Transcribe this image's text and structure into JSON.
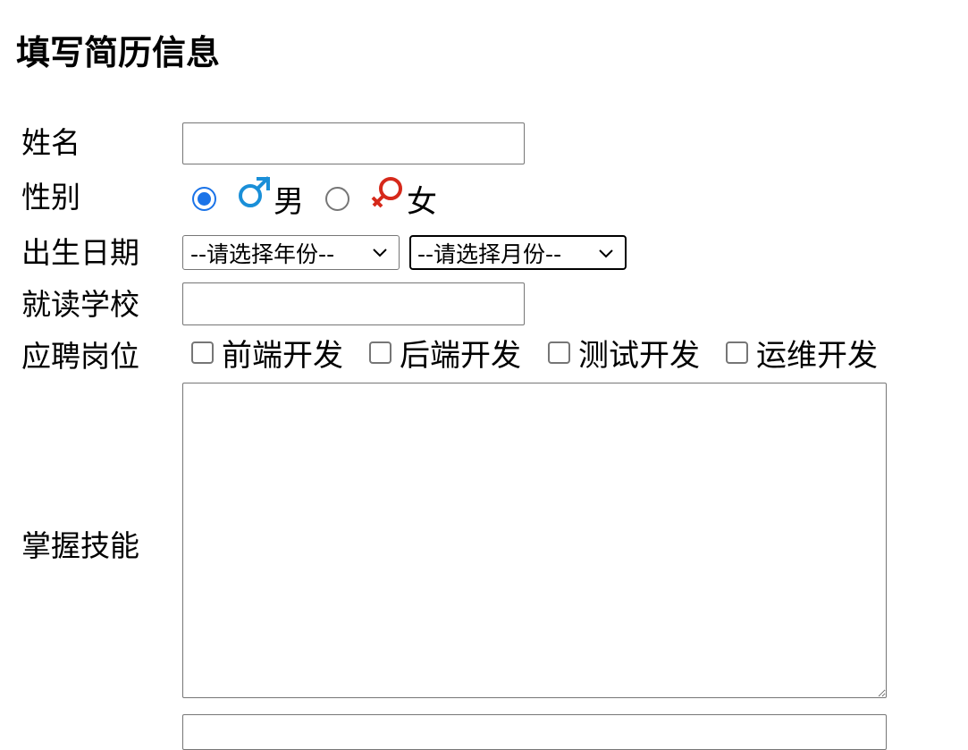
{
  "form": {
    "title": "填写简历信息",
    "name": {
      "label": "姓名",
      "value": ""
    },
    "gender": {
      "label": "性别",
      "options": [
        {
          "label": "男",
          "icon": "male-symbol-icon",
          "color": "#1a8fd8",
          "checked": true
        },
        {
          "label": "女",
          "icon": "female-symbol-icon",
          "color": "#d6291b",
          "checked": false
        }
      ]
    },
    "birthdate": {
      "label": "出生日期",
      "year_select": "--请选择年份--",
      "month_select": "--请选择月份--"
    },
    "school": {
      "label": "就读学校",
      "value": ""
    },
    "position": {
      "label": "应聘岗位",
      "options": [
        "前端开发",
        "后端开发",
        "测试开发",
        "运维开发"
      ]
    },
    "skills": {
      "label": "掌握技能",
      "value": ""
    }
  },
  "colors": {
    "accent": "#1a73e8",
    "border": "#767676"
  }
}
